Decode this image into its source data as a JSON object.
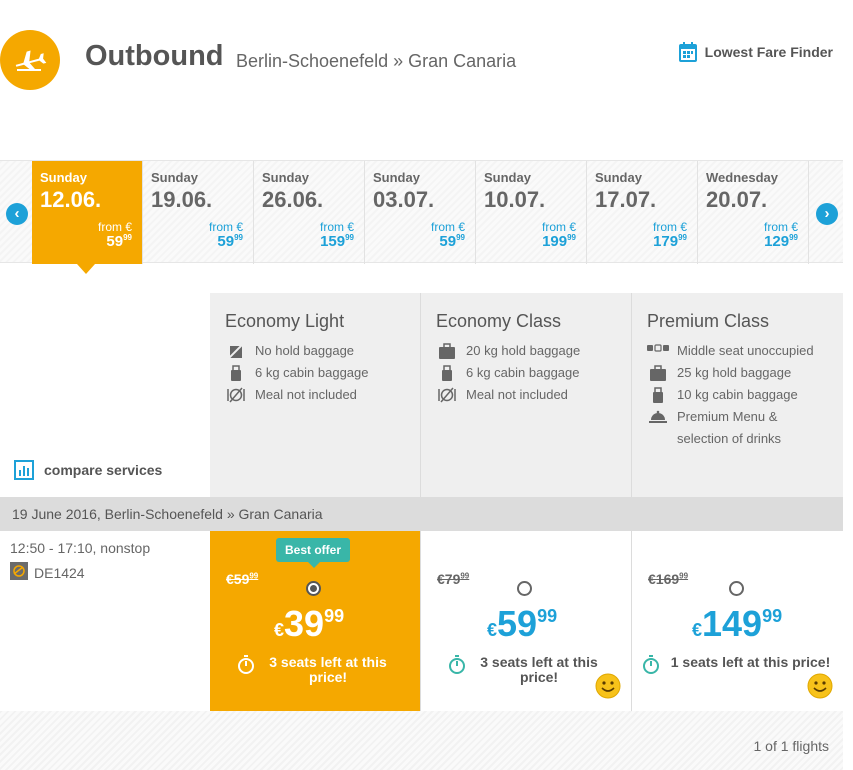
{
  "header": {
    "title": "Outbound",
    "route": "Berlin-Schoenefeld » Gran Canaria",
    "fare_finder": "Lowest Fare Finder"
  },
  "dates": [
    {
      "weekday": "Sunday",
      "date": "12.06.",
      "from": "from €",
      "price": "59",
      "cents": "99"
    },
    {
      "weekday": "Sunday",
      "date": "19.06.",
      "from": "from €",
      "price": "59",
      "cents": "99"
    },
    {
      "weekday": "Sunday",
      "date": "26.06.",
      "from": "from €",
      "price": "159",
      "cents": "99"
    },
    {
      "weekday": "Sunday",
      "date": "03.07.",
      "from": "from €",
      "price": "59",
      "cents": "99"
    },
    {
      "weekday": "Sunday",
      "date": "10.07.",
      "from": "from €",
      "price": "199",
      "cents": "99"
    },
    {
      "weekday": "Sunday",
      "date": "17.07.",
      "from": "from €",
      "price": "179",
      "cents": "99"
    },
    {
      "weekday": "Wednesday",
      "date": "20.07.",
      "from": "from €",
      "price": "129",
      "cents": "99"
    }
  ],
  "classes": [
    {
      "title": "Economy Light",
      "features": [
        "No hold baggage",
        "6 kg cabin baggage",
        "Meal not included"
      ]
    },
    {
      "title": "Economy Class",
      "features": [
        "20 kg hold baggage",
        "6 kg cabin baggage",
        "Meal not included"
      ]
    },
    {
      "title": "Premium Class",
      "features": [
        "Middle seat unoccupied",
        "25 kg hold baggage",
        "10 kg cabin baggage",
        "Premium Menu & selection of drinks"
      ]
    }
  ],
  "compare": "compare services",
  "flight": {
    "date_line": "19 June 2016, Berlin-Schoenefeld » Gran Canaria",
    "times": "12:50 - 17:10, nonstop",
    "number": "DE1424"
  },
  "fares": [
    {
      "badge": "Best offer",
      "old": "€59",
      "old_cents": "99",
      "cur": "€",
      "price": "39",
      "cents": "99",
      "seats": "3 seats left at this price!"
    },
    {
      "old": "€79",
      "old_cents": "99",
      "cur": "€",
      "price": "59",
      "cents": "99",
      "seats": "3 seats left at this price!"
    },
    {
      "old": "€169",
      "old_cents": "99",
      "cur": "€",
      "price": "149",
      "cents": "99",
      "seats": "1 seats left at this price!"
    }
  ],
  "footer": {
    "count": "1 of 1 flights"
  },
  "colors": {
    "accent": "#f5a800",
    "blue": "#1da1d8",
    "teal": "#39b6a8"
  }
}
